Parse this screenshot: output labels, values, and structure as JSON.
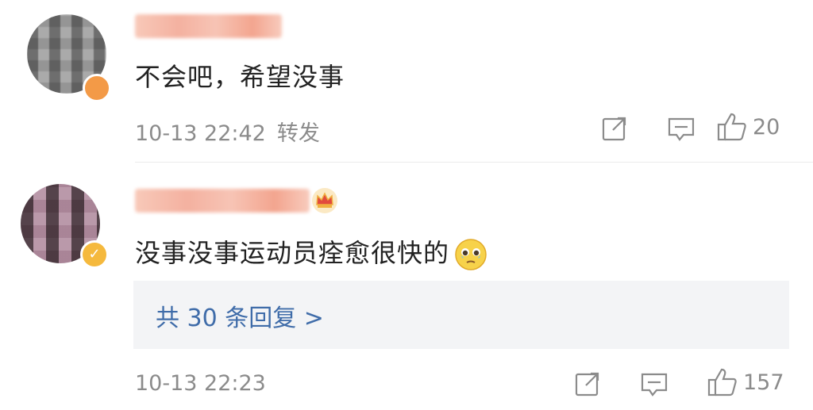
{
  "comments": [
    {
      "text": "不会吧，希望没事",
      "time": "10-13 22:42",
      "repost_label": "转发",
      "likes": "20",
      "avatar_badge_color": "#f39a47"
    },
    {
      "text": "没事没事运动员痊愈很快的",
      "emoji": "teary-face-emoji",
      "replies_label": "共 30 条回复 >",
      "time": "10-13 22:23",
      "likes": "157",
      "avatar_badge_color": "#f5b93d"
    }
  ],
  "colors": {
    "link": "#3f6ca9",
    "meta": "#8b8b8b",
    "reply_bg": "#f3f4f6"
  }
}
